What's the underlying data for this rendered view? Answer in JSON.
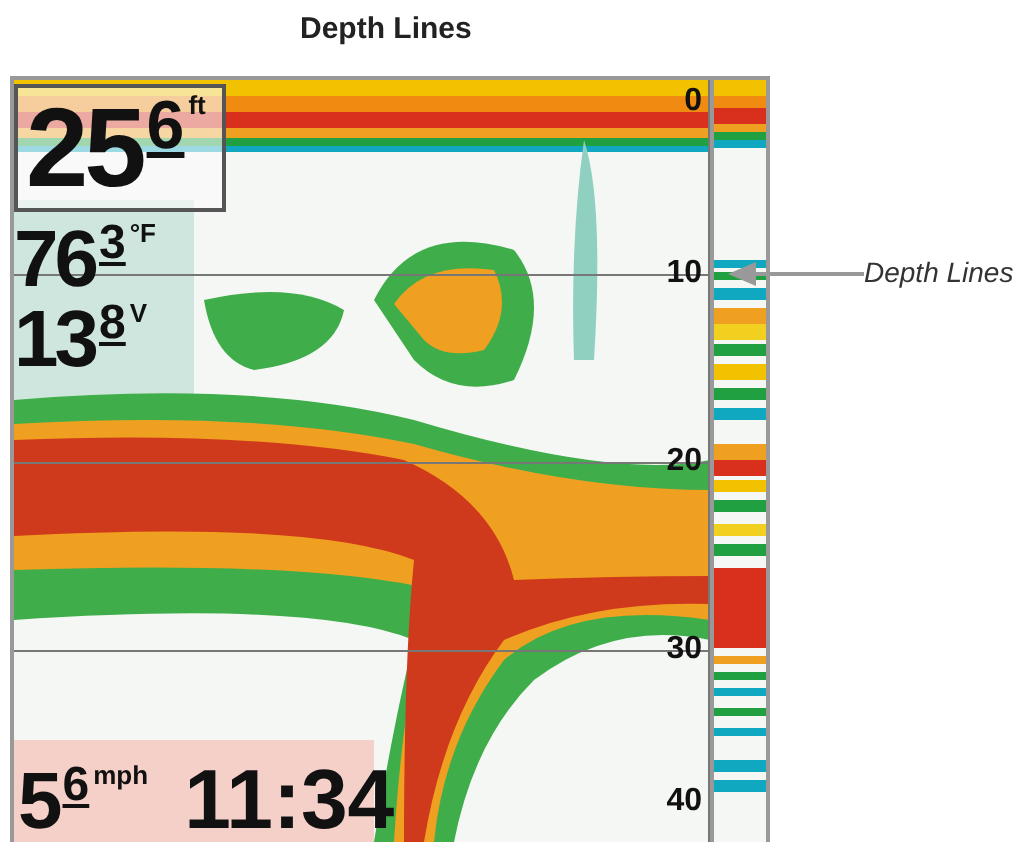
{
  "title": "Depth Lines",
  "readouts": [
    {
      "kind": "boxed",
      "whole": "25",
      "tenths": "6",
      "unit": "ft"
    },
    {
      "kind": "plain",
      "whole": "76",
      "tenths": "3",
      "unit": "°F"
    },
    {
      "kind": "plain",
      "whole": "13",
      "tenths": "8",
      "unit": "V"
    }
  ],
  "speed": {
    "whole": "5",
    "tenths": "6",
    "unit": "mph"
  },
  "time": "11:34",
  "depth_scale": [
    "0",
    "10",
    "20",
    "30",
    "40"
  ],
  "callout": "Depth Lines"
}
